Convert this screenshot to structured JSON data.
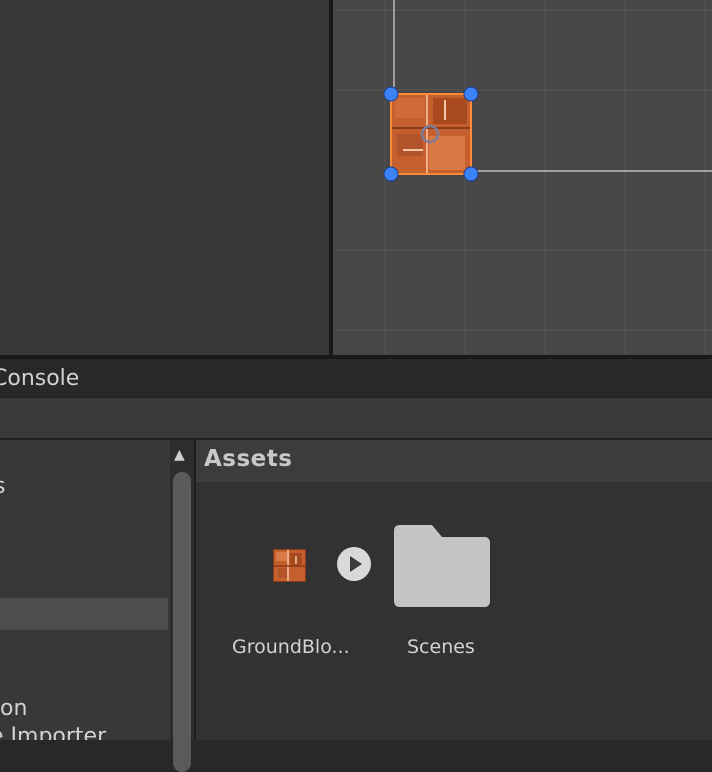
{
  "window": {
    "tab_label": "Console"
  },
  "project_tree": {
    "items": [
      {
        "label": "s"
      },
      {
        "label": "on"
      },
      {
        "label": "e Importer"
      }
    ]
  },
  "assets_panel": {
    "breadcrumb": "Assets",
    "items": [
      {
        "label": "GroundBlo...",
        "icon": "sprite-icon"
      },
      {
        "label": "Scenes",
        "icon": "folder-icon"
      }
    ]
  },
  "colors": {
    "selection_handle": "#3b82f6",
    "sprite_orange": "#c55f2d"
  }
}
